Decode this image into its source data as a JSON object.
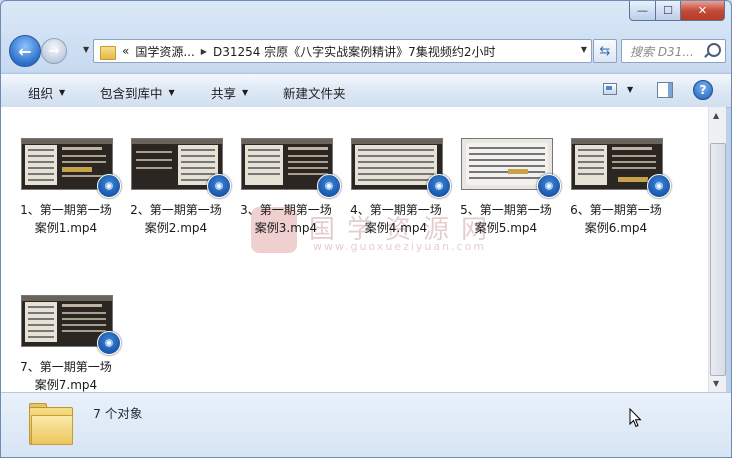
{
  "window": {
    "minimize_glyph": "—",
    "maximize_glyph": "☐",
    "close_glyph": "✕"
  },
  "navbar": {
    "back_glyph": "←",
    "forward_glyph": "→",
    "breadcrumb_prefix": "«",
    "breadcrumb_1": "国学资源...",
    "breadcrumb_2": "D31254 宗原《八字实战案例精讲》7集视频约2小时",
    "search_placeholder": "搜索 D31..."
  },
  "toolbar": {
    "organize": "组织",
    "include_in_library": "包含到库中",
    "share": "共享",
    "new_folder": "新建文件夹",
    "help_glyph": "?"
  },
  "files": [
    {
      "name_line1": "1、第一期第一场",
      "name_line2": "案例1.mp4"
    },
    {
      "name_line1": "2、第一期第一场",
      "name_line2": "案例2.mp4"
    },
    {
      "name_line1": "3、第一期第一场",
      "name_line2": "案例3.mp4"
    },
    {
      "name_line1": "4、第一期第一场",
      "name_line2": "案例4.mp4"
    },
    {
      "name_line1": "5、第一期第一场",
      "name_line2": "案例5.mp4"
    },
    {
      "name_line1": "6、第一期第一场",
      "name_line2": "案例6.mp4"
    },
    {
      "name_line1": "7、第一期第一场",
      "name_line2": "案例7.mp4"
    }
  ],
  "watermark": {
    "seal_text": "国学",
    "text": "国学资源网",
    "url": "www.guoxueziyuan.com"
  },
  "details": {
    "item_count": "7 个对象"
  },
  "icons": {
    "back": "back-arrow-icon",
    "forward": "forward-arrow-icon",
    "refresh": "refresh-icon",
    "search": "search-icon",
    "help": "help-icon",
    "video": "media-player-icon",
    "folder": "folder-icon"
  }
}
